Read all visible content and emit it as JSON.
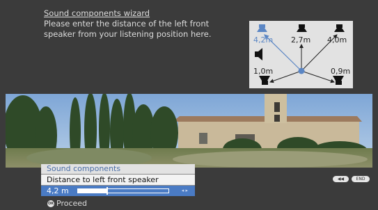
{
  "wizard": {
    "title": "Sound components wizard",
    "instruction": "Please enter the distance of the left front speaker from your listening position here."
  },
  "speakers": {
    "front_left": "4,2m",
    "center": "2,7m",
    "front_right": "4,0m",
    "rear_left": "1,0m",
    "rear_right": "0,9m"
  },
  "menu": {
    "header": "Sound components",
    "item": "Distance to left front speaker",
    "slider_value": "4,2 m",
    "slider_fraction": 0.32
  },
  "footer": {
    "proceed_label": "Proceed",
    "ok_icon_text": "OK",
    "end_label": "END"
  },
  "colors": {
    "accent": "#4a7bc4",
    "selected_speaker": "#5b86c4"
  },
  "icons": [
    "ok-icon",
    "rewind-icon",
    "speaker-icon",
    "listening-position-icon"
  ]
}
